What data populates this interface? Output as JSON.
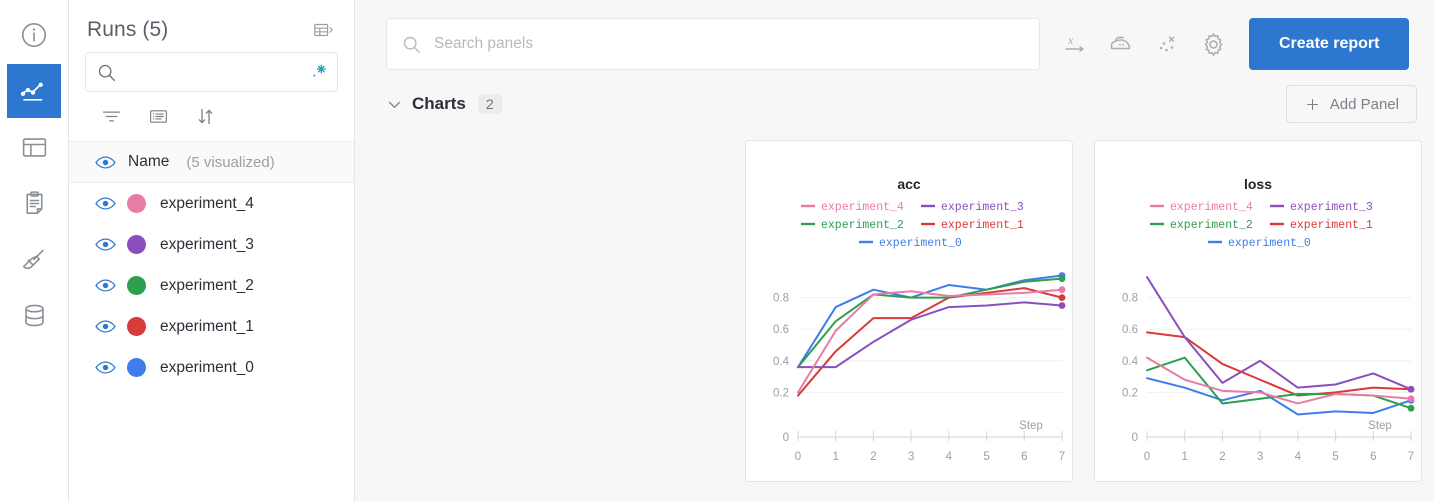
{
  "rail": {
    "items": [
      {
        "name": "info-icon",
        "label": "Info",
        "active": false
      },
      {
        "name": "chart-icon",
        "label": "Charts",
        "active": true
      },
      {
        "name": "table-layout-icon",
        "label": "Table",
        "active": false
      },
      {
        "name": "clipboard-icon",
        "label": "Reports",
        "active": false
      },
      {
        "name": "broom-icon",
        "label": "Sweeps",
        "active": false
      },
      {
        "name": "database-icon",
        "label": "Artifacts",
        "active": false
      }
    ]
  },
  "sidebar": {
    "title": "Runs (5)",
    "expand_icon": "table-expand-icon",
    "search": {
      "value": "",
      "placeholder": "",
      "icon": "search-icon",
      "magic_icon": "magic-wand-icon"
    },
    "tools": [
      {
        "name": "filter-icon",
        "label": "Filter"
      },
      {
        "name": "columns-icon",
        "label": "Columns"
      },
      {
        "name": "sort-icon",
        "label": "Sort"
      }
    ],
    "name_header": {
      "label": "Name",
      "sub": "(5 visualized)",
      "eye_icon": "eye-icon"
    },
    "runs": [
      {
        "name": "experiment_4",
        "color": "#e87ca5"
      },
      {
        "name": "experiment_3",
        "color": "#8a4fbd"
      },
      {
        "name": "experiment_2",
        "color": "#2e9e4f"
      },
      {
        "name": "experiment_1",
        "color": "#d93a3a"
      },
      {
        "name": "experiment_0",
        "color": "#3f7ee8"
      }
    ]
  },
  "toolbar": {
    "search": {
      "value": "",
      "placeholder": "Search panels",
      "icon": "search-icon"
    },
    "icons": [
      {
        "name": "x-axis-icon",
        "label": "X axis"
      },
      {
        "name": "smoothing-iron-icon",
        "label": "Smoothing"
      },
      {
        "name": "scatter-dots-icon",
        "label": "Outliers"
      },
      {
        "name": "gear-icon",
        "label": "Settings"
      }
    ],
    "create_report_label": "Create report"
  },
  "section": {
    "collapse_icon": "chevron-down-icon",
    "title": "Charts",
    "count": "2",
    "add_panel_label": "Add Panel",
    "add_panel_icon": "plus-icon"
  },
  "chart_data": [
    {
      "type": "line",
      "title": "acc",
      "xlabel": "Step",
      "ylabel": "",
      "x": [
        0,
        1,
        2,
        3,
        4,
        5,
        6,
        7
      ],
      "xlim": [
        0,
        7
      ],
      "ylim": [
        0,
        1.0
      ],
      "yticks": [
        "0",
        "0.2",
        "0.4",
        "0.6",
        "0.8"
      ],
      "ytickvals": [
        0,
        0.2,
        0.4,
        0.6,
        0.8
      ],
      "xticks": [
        "0",
        "1",
        "2",
        "3",
        "4",
        "5",
        "6",
        "7"
      ],
      "grid": true,
      "legend_position": "top",
      "series": [
        {
          "name": "experiment_4",
          "color": "#e87ca5",
          "values": [
            0.2,
            0.59,
            0.82,
            0.84,
            0.81,
            0.82,
            0.83,
            0.85
          ]
        },
        {
          "name": "experiment_3",
          "color": "#8a4fbd",
          "values": [
            0.36,
            0.36,
            0.52,
            0.66,
            0.74,
            0.75,
            0.77,
            0.75
          ]
        },
        {
          "name": "experiment_2",
          "color": "#2e9e4f",
          "values": [
            0.36,
            0.65,
            0.82,
            0.8,
            0.8,
            0.85,
            0.9,
            0.92
          ]
        },
        {
          "name": "experiment_1",
          "color": "#d93a3a",
          "values": [
            0.18,
            0.46,
            0.67,
            0.67,
            0.8,
            0.83,
            0.86,
            0.8
          ]
        },
        {
          "name": "experiment_0",
          "color": "#3f7ee8",
          "values": [
            0.36,
            0.74,
            0.85,
            0.8,
            0.88,
            0.85,
            0.91,
            0.94
          ]
        }
      ]
    },
    {
      "type": "line",
      "title": "loss",
      "xlabel": "Step",
      "ylabel": "",
      "x": [
        0,
        1,
        2,
        3,
        4,
        5,
        6,
        7
      ],
      "xlim": [
        0,
        7
      ],
      "ylim": [
        0,
        1.0
      ],
      "yticks": [
        "0",
        "0.2",
        "0.4",
        "0.6",
        "0.8"
      ],
      "ytickvals": [
        0,
        0.2,
        0.4,
        0.6,
        0.8
      ],
      "xticks": [
        "0",
        "1",
        "2",
        "3",
        "4",
        "5",
        "6",
        "7"
      ],
      "grid": true,
      "legend_position": "top",
      "series": [
        {
          "name": "experiment_4",
          "color": "#e87ca5",
          "values": [
            0.42,
            0.28,
            0.21,
            0.2,
            0.13,
            0.19,
            0.18,
            0.16
          ]
        },
        {
          "name": "experiment_3",
          "color": "#8a4fbd",
          "values": [
            0.93,
            0.55,
            0.26,
            0.4,
            0.23,
            0.25,
            0.32,
            0.22
          ]
        },
        {
          "name": "experiment_2",
          "color": "#2e9e4f",
          "values": [
            0.34,
            0.42,
            0.13,
            0.16,
            0.19,
            0.19,
            0.18,
            0.1
          ]
        },
        {
          "name": "experiment_1",
          "color": "#d93a3a",
          "values": [
            0.58,
            0.55,
            0.38,
            0.28,
            0.18,
            0.2,
            0.23,
            0.22
          ]
        },
        {
          "name": "experiment_0",
          "color": "#3f7ee8",
          "values": [
            0.29,
            0.23,
            0.15,
            0.21,
            0.06,
            0.08,
            0.07,
            0.15
          ]
        }
      ]
    }
  ]
}
